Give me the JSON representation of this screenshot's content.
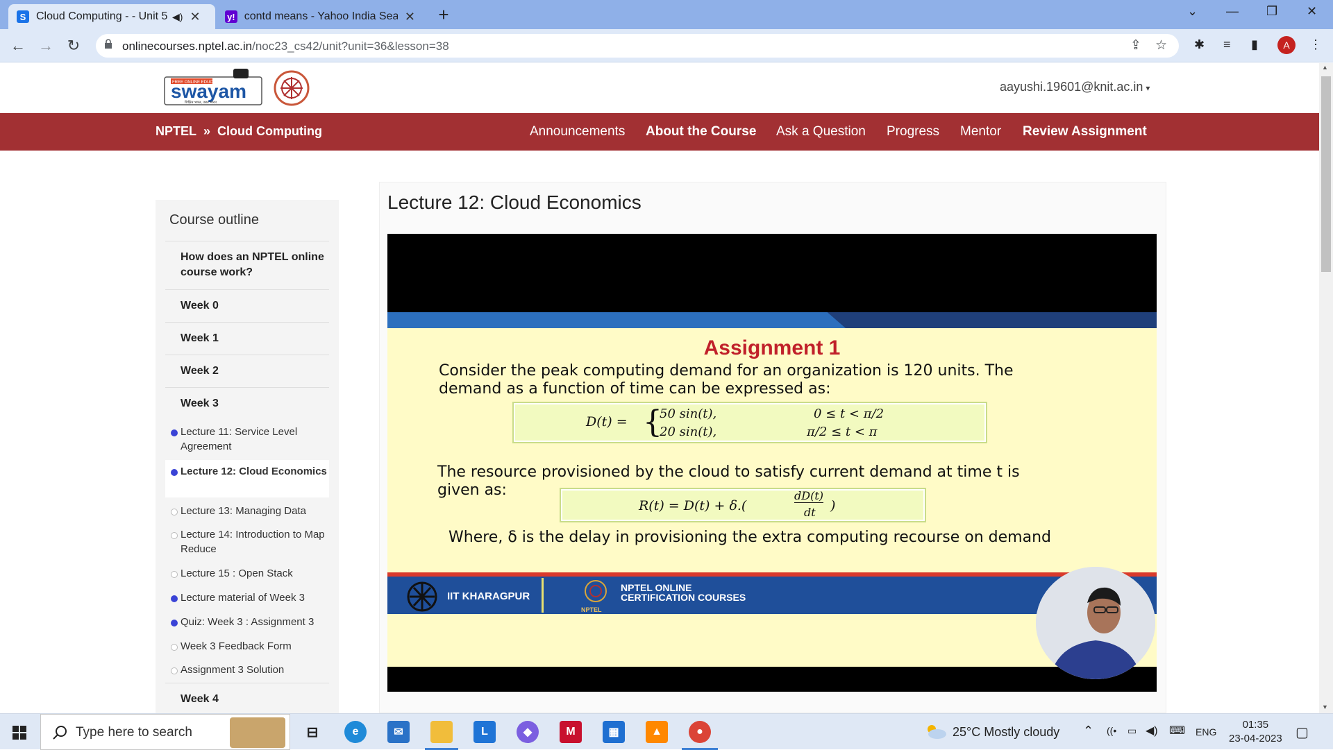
{
  "browser": {
    "tabs": [
      {
        "title": "Cloud Computing - - Unit 5",
        "active": true
      },
      {
        "title": "contd means - Yahoo India Searc",
        "active": false
      }
    ],
    "url_host": "onlinecourses.nptel.ac.in",
    "url_path": "/noc23_cs42/unit?unit=36&lesson=38",
    "profile_initial": "A"
  },
  "header": {
    "logo_text": "swayam",
    "logo_badge": "FREE ONLINE EDUCATION",
    "logo_tagline": "शिक्षित भारत, उन्नत भारत",
    "user_email": "aayushi.19601@knit.ac.in"
  },
  "nav": {
    "crumb_home": "NPTEL",
    "crumb_sep": "»",
    "crumb_course": "Cloud Computing",
    "items": [
      "Announcements",
      "About the Course",
      "Ask a Question",
      "Progress",
      "Mentor",
      "Review Assignment"
    ]
  },
  "outline": {
    "heading": "Course outline",
    "sections": [
      "How does an NPTEL online course work?",
      "Week 0",
      "Week 1",
      "Week 2",
      "Week 3",
      "Week 4"
    ],
    "lessons": [
      {
        "label": "Lecture 11: Service Level Agreement",
        "done": true
      },
      {
        "label": "Lecture 12: Cloud Economics",
        "done": true
      },
      {
        "label": "Lecture 13: Managing Data",
        "done": false
      },
      {
        "label": "Lecture 14: Introduction to Map Reduce",
        "done": false
      },
      {
        "label": "Lecture 15 : Open Stack",
        "done": false
      },
      {
        "label": "Lecture material of Week 3",
        "done": true
      },
      {
        "label": "Quiz: Week 3 : Assignment 3",
        "done": true
      },
      {
        "label": "Week 3 Feedback Form",
        "done": false
      },
      {
        "label": "Assignment 3 Solution",
        "done": false
      }
    ]
  },
  "main": {
    "lecture_title": "Lecture 12: Cloud Economics"
  },
  "slide": {
    "title": "Assignment 1",
    "para1_line1": "Consider the peak computing demand for an organization is 120 units. The",
    "para1_line2": "demand as a function of time can be expressed as:",
    "eq1_lhs": "D(t) =",
    "eq1_case1": "50 sin(t),",
    "eq1_case2": "20 sin(t),",
    "eq1_cond1": "0 ≤ t < π/2",
    "eq1_cond2": "π/2 ≤ t < π",
    "para2_line1": "The resource provisioned by the cloud to satisfy current demand at time t is",
    "para2_line2": "given as:",
    "eq2_left": "R(t) = D(t) + δ.(",
    "eq2_num": "dD(t)",
    "eq2_den": "dt",
    "eq2_right": ")",
    "where_line": "Where, δ is the delay in provisioning the extra computing recourse on demand",
    "footer_left": "IIT KHARAGPUR",
    "footer_right_1": "NPTEL ONLINE",
    "footer_right_2": "CERTIFICATION COURSES",
    "footer_small": "NPTEL"
  },
  "taskbar": {
    "search_placeholder": "Type here to search",
    "weather": "25°C  Mostly cloudy",
    "lang": "ENG",
    "time": "01:35",
    "date": "23-04-2023"
  }
}
